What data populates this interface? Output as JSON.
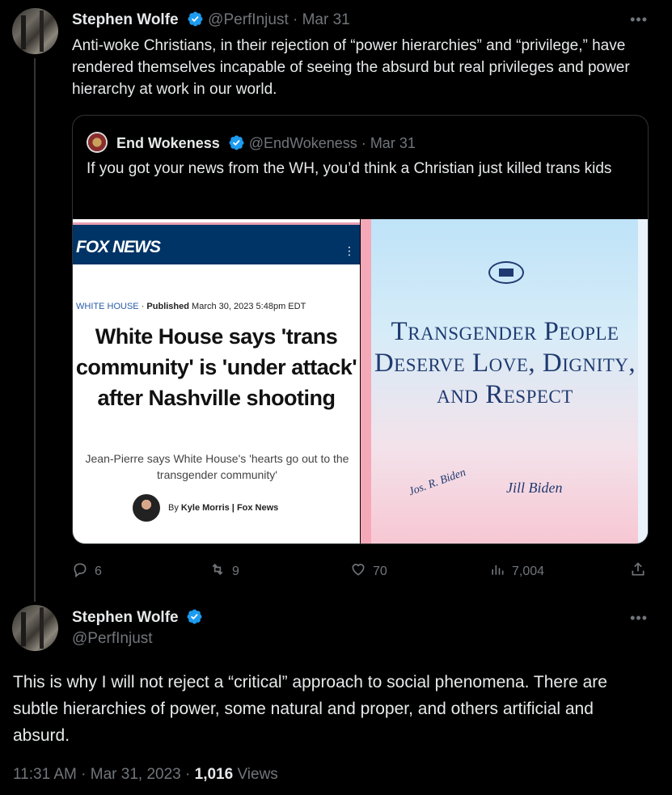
{
  "tweet1": {
    "name": "Stephen Wolfe",
    "handle": "@PerfInjust",
    "time_sep": "·",
    "time": "Mar 31",
    "text": "Anti-woke Christians, in their rejection of “power hierarchies” and “privilege,” have rendered themselves incapable of seeing the absurd but real privileges and power hierarchy at work in our world.",
    "more_icon": "more-icon",
    "quote": {
      "name": "End Wokeness",
      "handle": "@EndWokeness",
      "time_sep": "·",
      "time": "Mar 31",
      "text": "If you got your news from the WH, you’d think a Christian just killed trans kids",
      "media_left": {
        "logo": "FOX NEWS",
        "category": "WHITE HOUSE",
        "published_label": "Published",
        "published_date": "March 30, 2023 5:48pm EDT",
        "headline": "White House says 'trans community' is 'under attack' after Nashville shooting",
        "subhead": "Jean-Pierre says White House's 'hearts go out to the transgender community'",
        "byline_by": "By",
        "byline": "Kyle Morris | Fox News"
      },
      "media_right": {
        "title": "Transgender People Deserve Love, Dignity, and Respect",
        "signature_1": "Jos. R. Biden",
        "signature_2": "Jill Biden"
      }
    },
    "actions": {
      "replies": "6",
      "retweets": "9",
      "likes": "70",
      "views": "7,004"
    }
  },
  "tweet2": {
    "name": "Stephen Wolfe",
    "handle": "@PerfInjust",
    "text": "This is why I will not reject a “critical” approach to social phenomena. There are subtle hierarchies of power, some natural and proper, and others artificial and absurd.",
    "time": "11:31 AM",
    "sep1": "·",
    "date": "Mar 31, 2023",
    "sep2": "·",
    "views_count": "1,016",
    "views_label": "Views"
  },
  "colors": {
    "background": "#000000",
    "text": "#e7e9ea",
    "muted": "#71767b",
    "verified": "#1d9bf0"
  }
}
